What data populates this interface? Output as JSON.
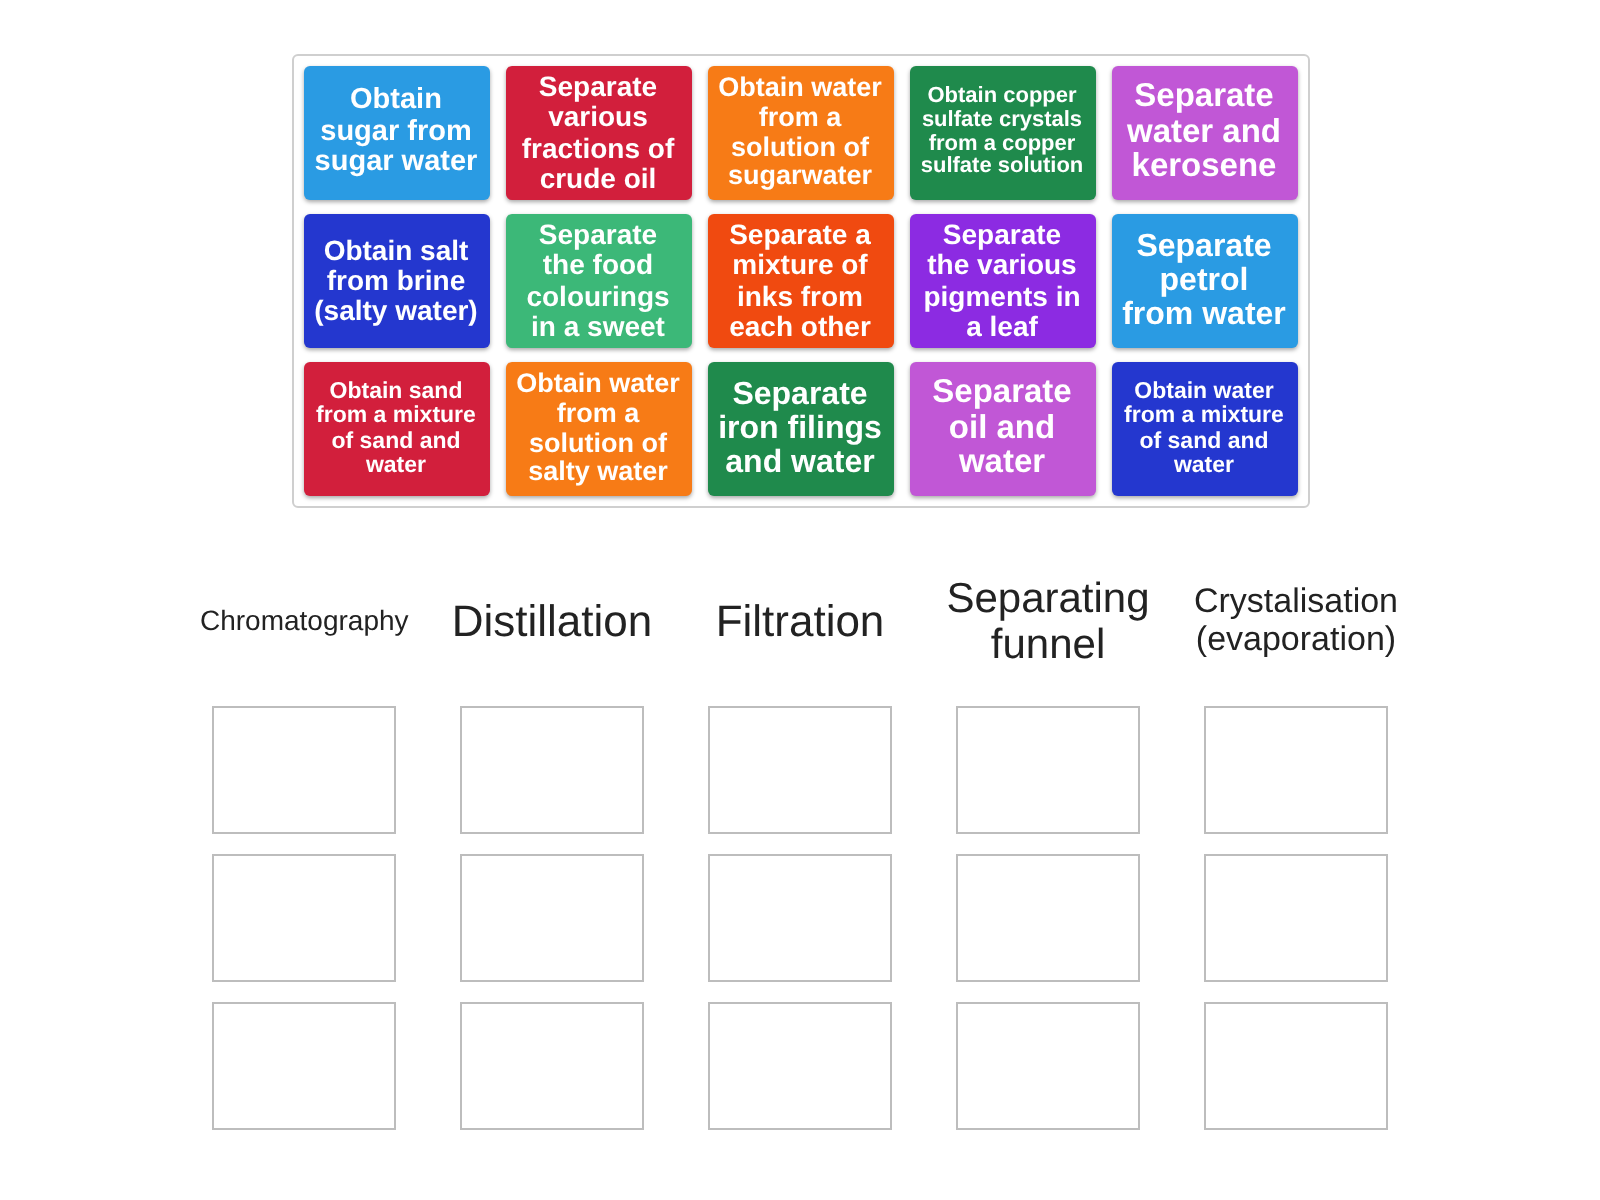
{
  "tiles": [
    {
      "text": "Obtain sugar from sugar water",
      "color": "#2a9be3"
    },
    {
      "text": "Separate various fractions of crude oil",
      "color": "#d21f3c"
    },
    {
      "text": "Obtain water from a solution of sugarwater",
      "color": "#f77b16"
    },
    {
      "text": "Obtain copper sulfate crystals from a copper sulfate solution",
      "color": "#1f8a4c"
    },
    {
      "text": "Separate water and kerosene",
      "color": "#c157d6"
    },
    {
      "text": "Obtain salt from brine (salty water)",
      "color": "#2437cf"
    },
    {
      "text": "Separate the food colourings in a sweet",
      "color": "#3cb878"
    },
    {
      "text": "Separate a mixture of inks from each other",
      "color": "#f04a10"
    },
    {
      "text": "Separate the various pigments in a leaf",
      "color": "#8c2be2"
    },
    {
      "text": "Separate petrol from water",
      "color": "#2a9be3"
    },
    {
      "text": "Obtain sand from a mixture of sand and water",
      "color": "#d21f3c"
    },
    {
      "text": "Obtain water from a solution of salty water",
      "color": "#f77b16"
    },
    {
      "text": "Separate iron filings and water",
      "color": "#1f8a4c"
    },
    {
      "text": "Separate oil and water",
      "color": "#c157d6"
    },
    {
      "text": "Obtain water from a mixture of sand and water",
      "color": "#2437cf"
    }
  ],
  "groups": [
    {
      "heading": "Chromatography"
    },
    {
      "heading": "Distillation"
    },
    {
      "heading": "Filtration"
    },
    {
      "heading": "Separating funnel"
    },
    {
      "heading": "Crystalisation (evaporation)"
    }
  ]
}
